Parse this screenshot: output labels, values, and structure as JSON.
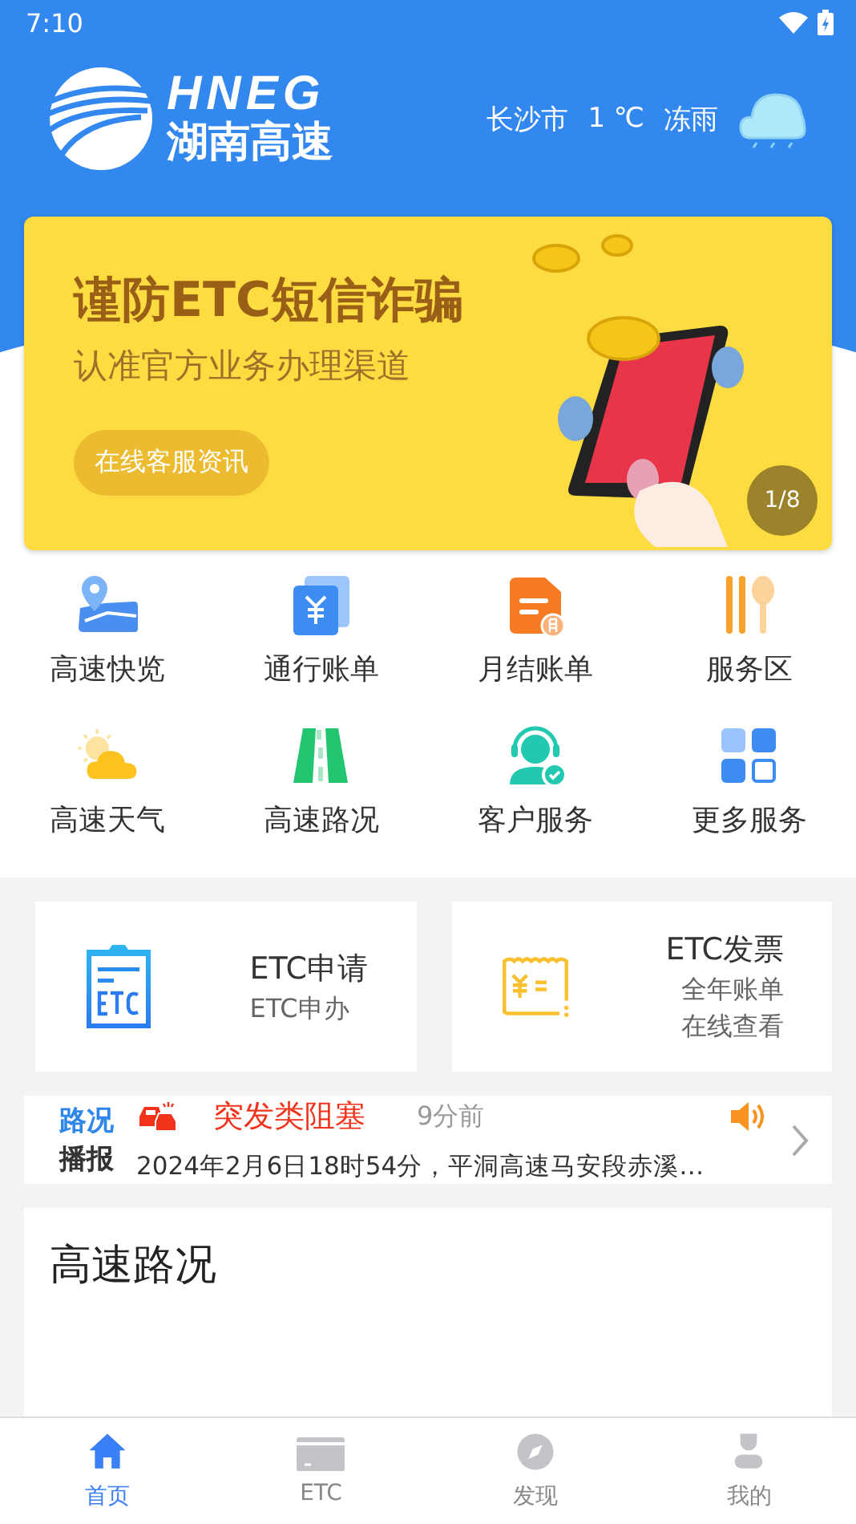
{
  "status_bar": {
    "time": "7:10"
  },
  "header": {
    "logo_text": "HNEG",
    "logo_subtitle": "湖南高速",
    "city": "长沙市",
    "temperature": "1 ℃",
    "weather": "冻雨"
  },
  "banner": {
    "title": "谨防ETC短信诈骗",
    "subtitle": "认准官方业务办理渠道",
    "button": "在线客服资讯",
    "counter": "1/8"
  },
  "services": [
    {
      "label": "高速快览",
      "kind": "map"
    },
    {
      "label": "通行账单",
      "kind": "bill"
    },
    {
      "label": "月结账单",
      "kind": "monthly"
    },
    {
      "label": "服务区",
      "kind": "dining"
    },
    {
      "label": "高速天气",
      "kind": "weather"
    },
    {
      "label": "高速路况",
      "kind": "road"
    },
    {
      "label": "客户服务",
      "kind": "support"
    },
    {
      "label": "更多服务",
      "kind": "more"
    }
  ],
  "etc_cards": [
    {
      "kind": "apply",
      "title": "ETC申请",
      "lines": [
        "ETC申办"
      ]
    },
    {
      "kind": "invoice",
      "title": "ETC发票",
      "lines": [
        "全年账单",
        "在线查看"
      ]
    }
  ],
  "news": {
    "badge_lines": [
      "路况",
      "播报"
    ],
    "category": "突发类阻塞",
    "time": "9分前",
    "text": "2024年2月6日18时54分，平洞高速马安段赤溪…"
  },
  "section": {
    "title": "高速路况"
  },
  "tabs": [
    {
      "label": "首页",
      "kind": "home",
      "selected": true
    },
    {
      "label": "ETC",
      "kind": "etc",
      "selected": false
    },
    {
      "label": "发现",
      "kind": "discover",
      "selected": false
    },
    {
      "label": "我的",
      "kind": "profile",
      "selected": false
    }
  ]
}
